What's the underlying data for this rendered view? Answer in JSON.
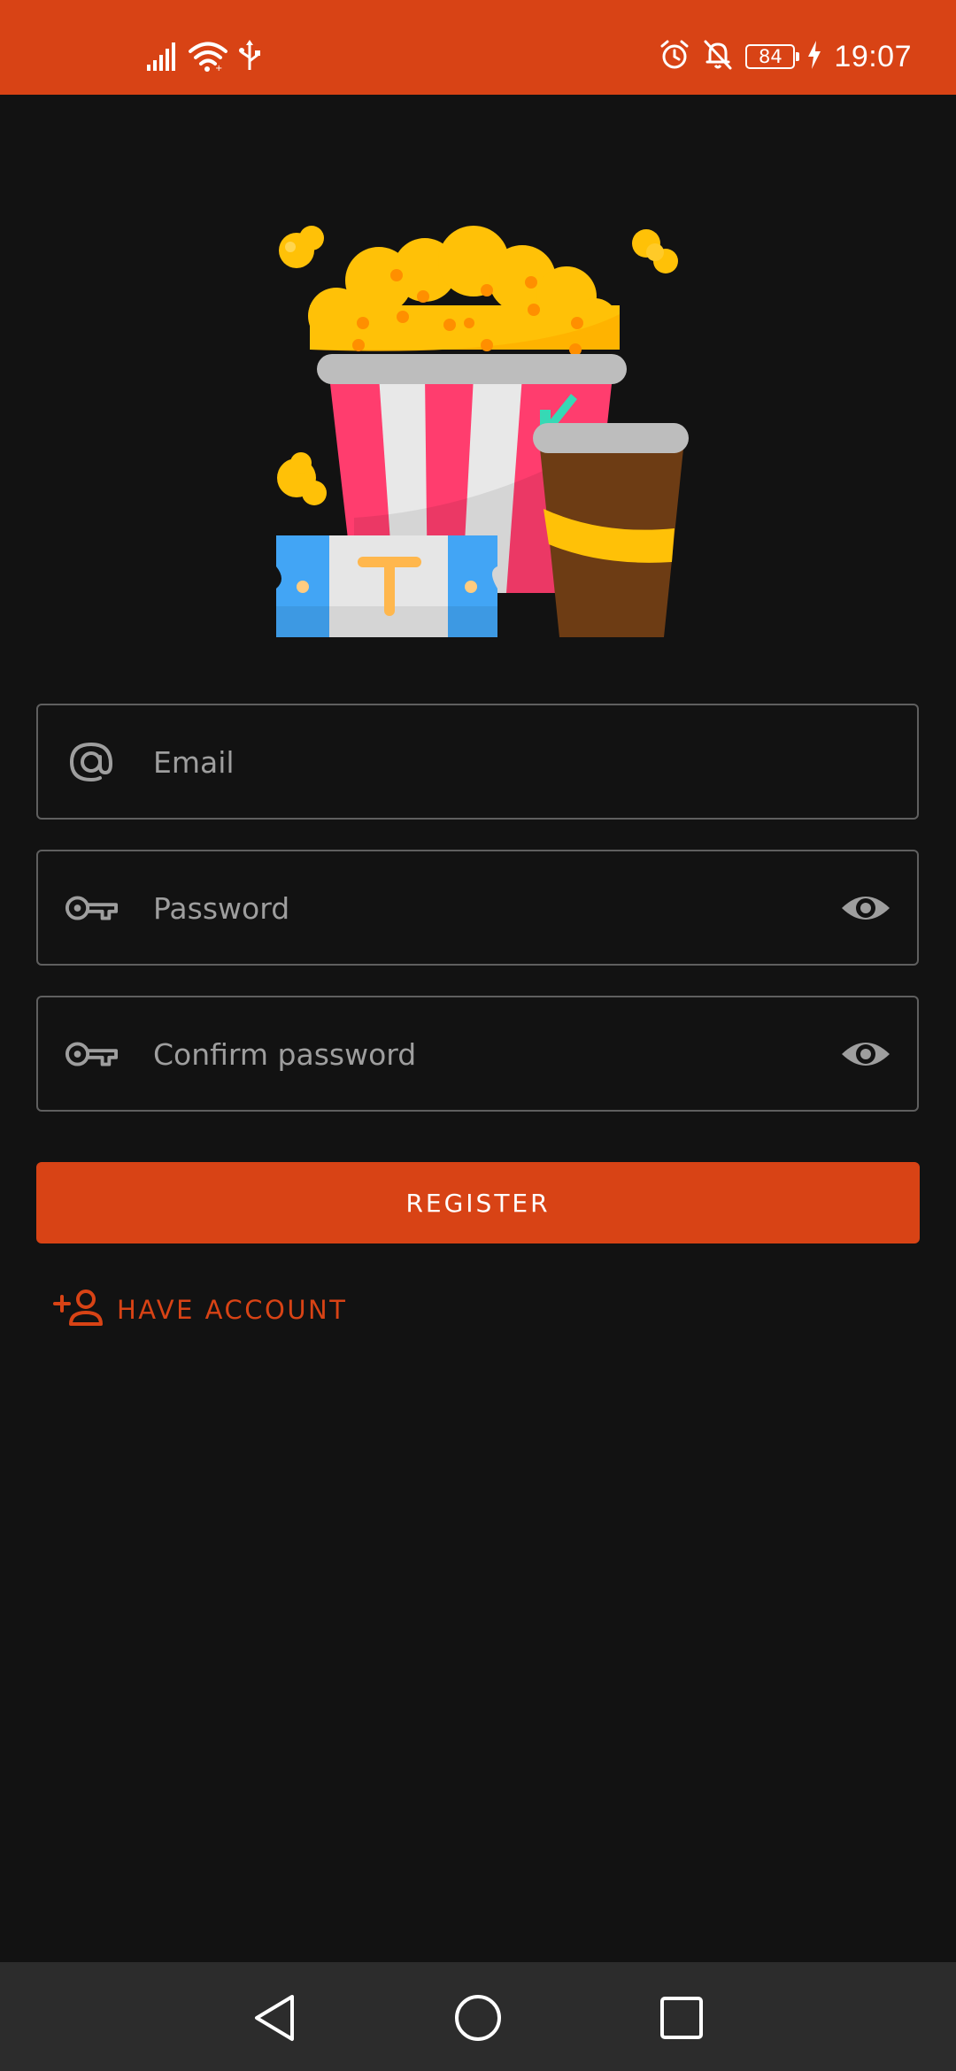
{
  "status_bar": {
    "time": "19:07",
    "battery_level": "84",
    "accent_color": "#d84315",
    "icons_left": [
      "signal-icon",
      "wifi-icon",
      "usb-icon"
    ],
    "icons_right": [
      "alarm-icon",
      "bell-off-icon",
      "battery-icon",
      "charging-icon"
    ]
  },
  "hero": {
    "illustration": "popcorn-soda-ticket-icon"
  },
  "form": {
    "email": {
      "placeholder": "Email",
      "value": "",
      "icon": "at-icon"
    },
    "password": {
      "placeholder": "Password",
      "value": "",
      "icon": "key-icon",
      "toggle_icon": "eye-icon"
    },
    "confirm_password": {
      "placeholder": "Confirm password",
      "value": "",
      "icon": "key-icon",
      "toggle_icon": "eye-icon"
    },
    "register_label": "REGISTER",
    "have_account_label": "HAVE ACCOUNT",
    "have_account_icon": "add-person-icon"
  },
  "nav_bar": {
    "buttons": [
      "back-triangle-icon",
      "home-circle-icon",
      "recents-square-icon"
    ]
  }
}
